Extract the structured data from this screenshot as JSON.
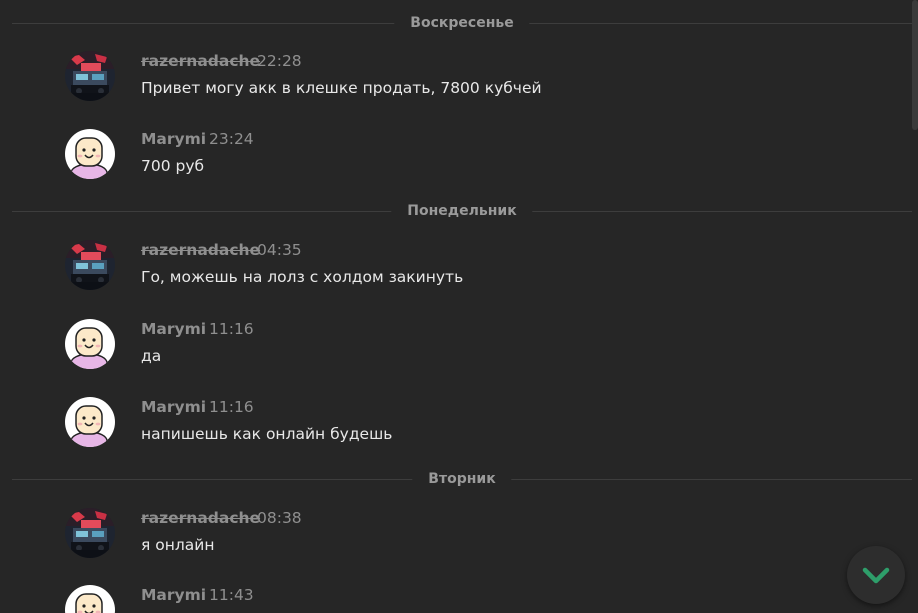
{
  "days": [
    "Воскресенье",
    "Понедельник",
    "Вторник"
  ],
  "messages": [
    {
      "author": "razernadache",
      "time": "22:28",
      "text": "Привет могу акк в клешке продать, 7800 кубчей"
    },
    {
      "author": "Marymi",
      "time": "23:24",
      "text": "700 руб"
    },
    {
      "author": "razernadache",
      "time": "04:35",
      "text": "Го, можешь на лолз с холдом закинуть"
    },
    {
      "author": "Marymi",
      "time": "11:16",
      "text": "да"
    },
    {
      "author": "Marymi",
      "time": "11:16",
      "text": "напишешь как онлайн будешь"
    },
    {
      "author": "razernadache",
      "time": "08:38",
      "text": "я онлайн"
    },
    {
      "author": "Marymi",
      "time": "11:43",
      "text": ""
    }
  ],
  "icons": {
    "scroll_down": "chevron-down-icon"
  },
  "colors": {
    "background": "#262626",
    "username": "#8f8f8f",
    "message_text": "#e8e8e8",
    "chevron": "#2e9e6a"
  }
}
